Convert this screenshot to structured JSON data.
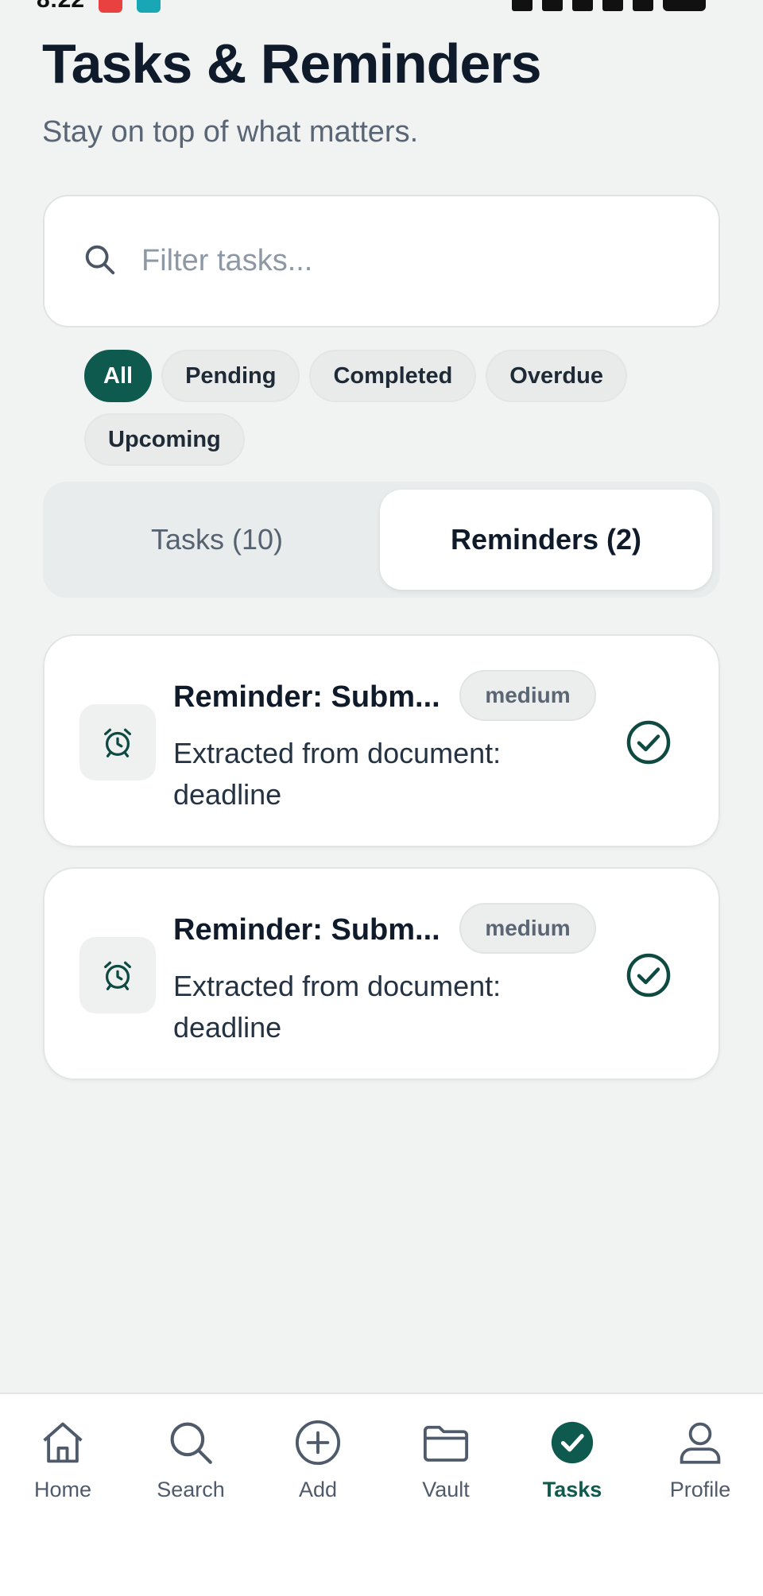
{
  "status_bar": {
    "time": "8:22"
  },
  "header": {
    "title": "Tasks & Reminders",
    "subtitle": "Stay on top of what matters."
  },
  "search": {
    "placeholder": "Filter tasks...",
    "value": ""
  },
  "filters": {
    "chips": [
      "All",
      "Pending",
      "Completed",
      "Overdue",
      "Upcoming"
    ],
    "selected": "All"
  },
  "segments": {
    "tasks_label": "Tasks (10)",
    "reminders_label": "Reminders (2)",
    "selected": "Reminders (2)"
  },
  "reminders": [
    {
      "title": "Reminder: Subm...",
      "priority": "medium",
      "description": "Extracted from document: deadline",
      "icon": "alarm-clock-icon"
    },
    {
      "title": "Reminder: Subm...",
      "priority": "medium",
      "description": "Extracted from document: deadline",
      "icon": "alarm-clock-icon"
    }
  ],
  "bottom_nav": {
    "items": [
      {
        "label": "Home",
        "icon": "home-icon"
      },
      {
        "label": "Search",
        "icon": "search-icon"
      },
      {
        "label": "Add",
        "icon": "plus-circle-icon"
      },
      {
        "label": "Vault",
        "icon": "folder-icon"
      },
      {
        "label": "Tasks",
        "icon": "check-circle-icon"
      },
      {
        "label": "Profile",
        "icon": "person-icon"
      }
    ],
    "active": "Tasks"
  },
  "colors": {
    "accent": "#0f5a4e",
    "background": "#f1f3f2",
    "text_primary": "#0f1b2a",
    "text_muted": "#5a6675"
  }
}
